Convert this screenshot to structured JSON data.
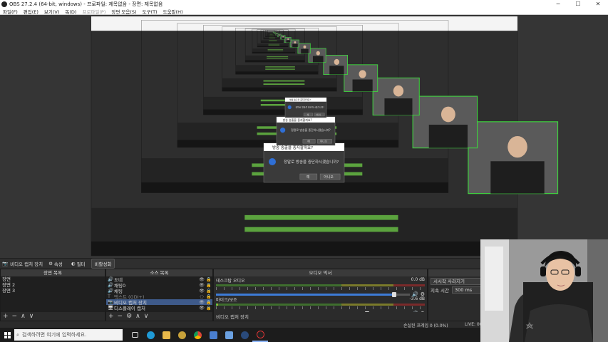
{
  "window": {
    "title": "OBS 27.2.4 (64-bit, windows) - 프로파일: 제목없음 - 장면: 제목없음",
    "minimize": "─",
    "maximize": "☐",
    "close": "✕"
  },
  "menu": [
    {
      "label": "파일(F)",
      "disabled": false
    },
    {
      "label": "편집(E)",
      "disabled": false
    },
    {
      "label": "보기(V)",
      "disabled": false
    },
    {
      "label": "독(D)",
      "disabled": false
    },
    {
      "label": "프로파일(P)",
      "disabled": true
    },
    {
      "label": "장면 모음(S)",
      "disabled": false
    },
    {
      "label": "도구(T)",
      "disabled": false
    },
    {
      "label": "도움말(H)",
      "disabled": false
    }
  ],
  "preview": {
    "dialog_title": "방송 송출을 중지할까요?",
    "dialog_message": "정말로 방송을 중단하시겠습니까?",
    "dialog_yes": "예",
    "dialog_no": "아니오",
    "border_color": "#3fd13f"
  },
  "context_bar": {
    "source_label": "비디오 캡처 장치",
    "properties": "속성",
    "filters": "필터",
    "activate": "비활성화"
  },
  "scenes": {
    "header": "장면 목록",
    "items": [
      "장면",
      "장면 2",
      "장면 3"
    ],
    "selected": 0
  },
  "sources": {
    "header": "소스 목록",
    "items": [
      {
        "icon": "🔊",
        "name": "도네",
        "dim": false
      },
      {
        "icon": "🔊",
        "name": "채팅0",
        "dim": false
      },
      {
        "icon": "🔊",
        "name": "채팅",
        "dim": false
      },
      {
        "icon": "T",
        "name": "텍스트 (GDI+)",
        "dim": true
      },
      {
        "icon": "📷",
        "name": "비디오 캡처 장치",
        "dim": false,
        "selected": true
      },
      {
        "icon": "🖥",
        "name": "디스플레이 캡처",
        "dim": false
      }
    ]
  },
  "mixer": {
    "header": "오디오 믹서",
    "channels": [
      {
        "name": "데스크탑 오디오",
        "db": "0.0 dB",
        "level": 0.0,
        "fader": 0.92
      },
      {
        "name": "마이크/보조",
        "db": "-3.6 dB",
        "level": 0.01,
        "fader": 0.78
      }
    ],
    "footer_label": "비디오 캡처 장치"
  },
  "transitions": {
    "header": "장면 전환",
    "selected": "시시작 사라지기",
    "duration_label": "지속 시간",
    "duration_value": "300 ms"
  },
  "status": {
    "dropped": "손실된 프레임 0 (0.0%)",
    "live": "LIVE: 00"
  },
  "taskbar": {
    "search_placeholder": "검색하려면 여기에 입력하세요."
  }
}
